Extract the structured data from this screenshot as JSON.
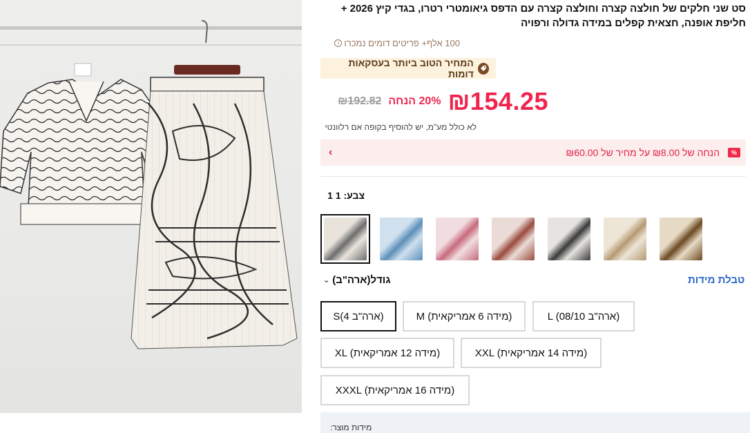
{
  "product": {
    "title_line1": "סט שני חלקים של חולצה קצרה וחולצה קצרה עם הדפס גיאומטרי רטרו, בגדי קיץ 2026 +",
    "title_line2": "חליפת אופנה, חצאית קפלים במידה גדולה ורפויה",
    "sold_text": "100 אלף+ פריטים דומים נמכרו",
    "best_price_badge": "המחיר הטוב ביותר בעסקאות דומות"
  },
  "price": {
    "current": "₪154.25",
    "discount": "20% הנחה",
    "original": "₪192.82",
    "vat_note": "לא כולל מע\"מ, יש להוסיף בקופה אם רלוונטי"
  },
  "coupon": {
    "icon_label": "%",
    "text": "הנחה של ₪8.00 על מחיר של ₪60.00",
    "chevron": "›"
  },
  "color": {
    "label": "צבע: 1 1",
    "swatches": [
      {
        "name": "white-black",
        "color": "#e8e4dc",
        "accent": "#6d6d6d"
      },
      {
        "name": "blue",
        "color": "#cfe0ee",
        "accent": "#5d8fb9"
      },
      {
        "name": "pink",
        "color": "#f1dde0",
        "accent": "#c76a7c"
      },
      {
        "name": "red-brown",
        "color": "#eadbd6",
        "accent": "#9a4b3e"
      },
      {
        "name": "black-white",
        "color": "#e6e4e0",
        "accent": "#3a3a3a"
      },
      {
        "name": "beige",
        "color": "#ede5d6",
        "accent": "#b59a73"
      },
      {
        "name": "brown-gold",
        "color": "#e7dac4",
        "accent": "#6b4a22"
      }
    ]
  },
  "size": {
    "guide_label": "טבלת מידות",
    "unit_label": "גודל(ארה\"ב)",
    "options": [
      {
        "label": "S(4 ארה\"ב)",
        "selected": true
      },
      {
        "label": "M (מידה 6 אמריקאית)",
        "selected": false
      },
      {
        "label": "L (08/10 ארה\"ב)",
        "selected": false
      },
      {
        "label": "XL (מידה 12 אמריקאית)",
        "selected": false
      },
      {
        "label": "XXL (מידה 14 אמריקאית)",
        "selected": false
      },
      {
        "label": "XXXL (מידה 16 אמריקאית)",
        "selected": false
      }
    ],
    "product_sizes_label": "מידות מוצר:"
  },
  "colors": {
    "price_red": "#f0254d",
    "link_blue": "#2a66c8",
    "badge_bg": "#fdf2dd",
    "coupon_bg": "#fdeeee"
  }
}
